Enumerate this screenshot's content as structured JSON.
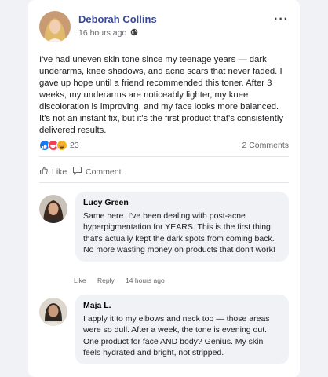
{
  "post": {
    "author": "Deborah Collins",
    "time": "16 hours ago",
    "more_icon": "···",
    "body": "I've had uneven skin tone since my teenage years — dark underarms, knee shadows, and acne scars that never faded. I gave up hope until a friend recommended this toner. After 3 weeks, my underarms are noticeably lighter, my knee discoloration is improving, and my face looks more balanced. It's not an instant fix, but it's the first product that's consistently delivered results.",
    "reaction_count": "23",
    "comments_count": "2 Comments"
  },
  "actions": {
    "like_label": "Like",
    "comment_label": "Comment"
  },
  "comments": [
    {
      "name": "Lucy Green",
      "text": "Same here. I've been dealing with post-acne hyperpigmentation for YEARS. This is the first thing that's actually kept the dark spots from coming back. No more wasting money on products that don't work!",
      "like": "Like",
      "reply": "Reply",
      "time": "14 hours ago"
    },
    {
      "name": "Maja L.",
      "text": "I apply it to my elbows and neck too — those areas were so dull. After a week, the tone is evening out. One product for face AND body? Genius. My skin feels hydrated and bright, not stripped."
    }
  ],
  "colors": {
    "author": "#3b4a96",
    "like_reaction": "#1877f2",
    "love_reaction": "#f33e58",
    "haha_reaction": "#f7b125"
  },
  "icons": {
    "privacy": "globe-icon",
    "like": "thumbs-up-icon",
    "comment": "comment-bubble-icon"
  }
}
